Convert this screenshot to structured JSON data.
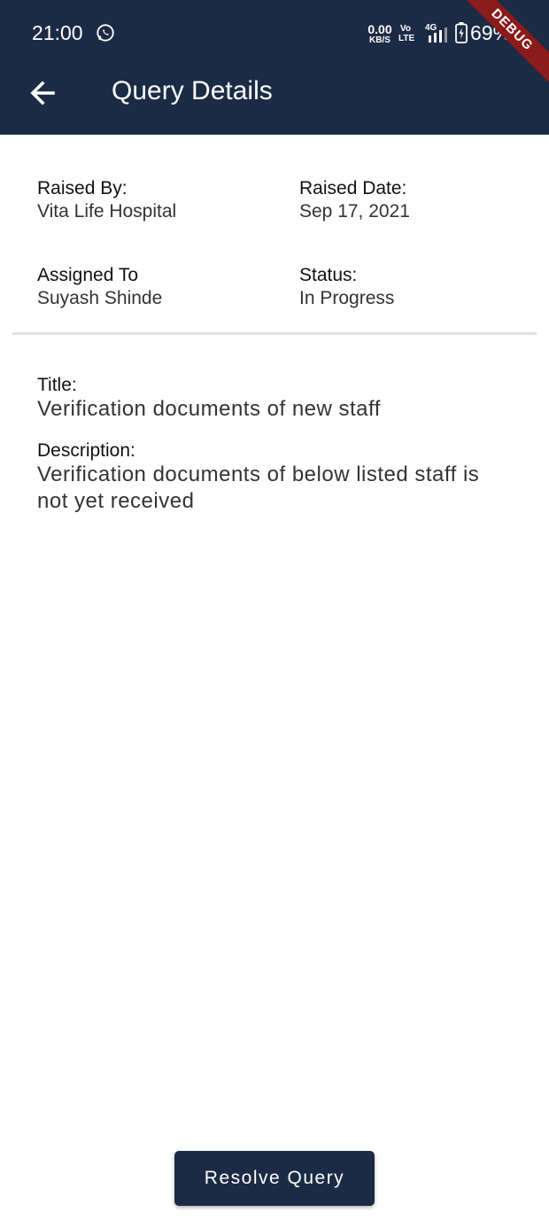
{
  "status_bar": {
    "time": "21:00",
    "net_speed": "0.00",
    "net_speed_unit": "KB/S",
    "volte_top": "Vo",
    "volte_bottom": "LTE",
    "network_type": "4G",
    "battery": "69%",
    "debug_banner": "DEBUG"
  },
  "header": {
    "title": "Query Details"
  },
  "details": {
    "raised_by": {
      "label": "Raised By:",
      "value": "Vita Life Hospital"
    },
    "raised_date": {
      "label": "Raised Date:",
      "value": "Sep 17, 2021"
    },
    "assigned_to": {
      "label": "Assigned To",
      "value": "Suyash Shinde"
    },
    "status": {
      "label": "Status:",
      "value": "In Progress"
    }
  },
  "query": {
    "title_label": "Title:",
    "title_value": "Verification documents of new staff",
    "description_label": "Description:",
    "description_value": "Verification documents of below listed staff is not yet received"
  },
  "actions": {
    "resolve_label": "Resolve Query"
  },
  "colors": {
    "primary": "#1c2b45",
    "debug_ribbon": "#8b1a1a",
    "divider": "#e0e0e0"
  }
}
